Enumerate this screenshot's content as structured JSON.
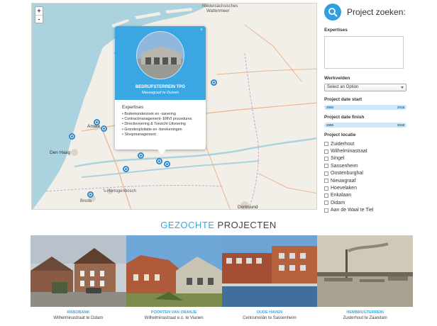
{
  "map": {
    "zoom_in": "+",
    "zoom_out": "-",
    "labels": {
      "niedersachsisches": "Niedersächsisches",
      "wattenmeer": "Wattenmeer",
      "amsterdam": "Amste",
      "den_haag": "Den Haag",
      "dortmund": "Dortmund",
      "s_hertogenbosch": "'s-Hertogenbosch",
      "breda": "Breda"
    }
  },
  "popup": {
    "close": "×",
    "title": "BEDRIJFSTERREIN TPG",
    "subtitle": "Nieuwgraaf te Duiven",
    "section": "Expertises",
    "items": [
      "• Bodemonderzoek en -sanering",
      "• Contractmanagement- EMVI procedures",
      "• Directievoering & Toezicht Uitvoering",
      "• Grondexploitatie en -berekeningen",
      "• Sloopmanagement"
    ]
  },
  "sidebar": {
    "title": "Project zoeken:",
    "expertises_label": "Expertises",
    "werkvelden_label": "Werkvelden",
    "werkvelden_value": "Select an Option",
    "date_start_label": "Project date start",
    "date_start_min": "2000",
    "date_start_max": "2018",
    "date_finish_label": "Project date finish",
    "date_finish_min": "2000",
    "date_finish_max": "2018",
    "locatie_label": "Project locatie",
    "locaties": [
      "Zuiderhout",
      "Wilhelminastraat",
      "Singel",
      "Sassenheim",
      "Oostenburghal",
      "Nieuwgraaf",
      "Hoevelaken",
      "Enkalaan",
      "Didam",
      "Aan de Waal te Tiel"
    ]
  },
  "section": {
    "title_highlight": "GEZOCHTE",
    "title_rest": " PROJECTEN"
  },
  "projects": [
    {
      "title": "RABOBANK",
      "subtitle": "Wilhelminastraat te Didam"
    },
    {
      "title": "POORTEN VAN ORANJE",
      "subtitle": "Wilhelminastraat e.o. te Vianen"
    },
    {
      "title": "OUDE HAVEN",
      "subtitle": "Centrumolân te Sassenheim"
    },
    {
      "title": "HEMBRUGTERREIN",
      "subtitle": "Zuiderhout te Zaandam"
    }
  ],
  "colors": {
    "accent": "#3aa7e3",
    "marker": "#2f86c8",
    "water": "#aad3df",
    "land": "#f2efe9"
  }
}
